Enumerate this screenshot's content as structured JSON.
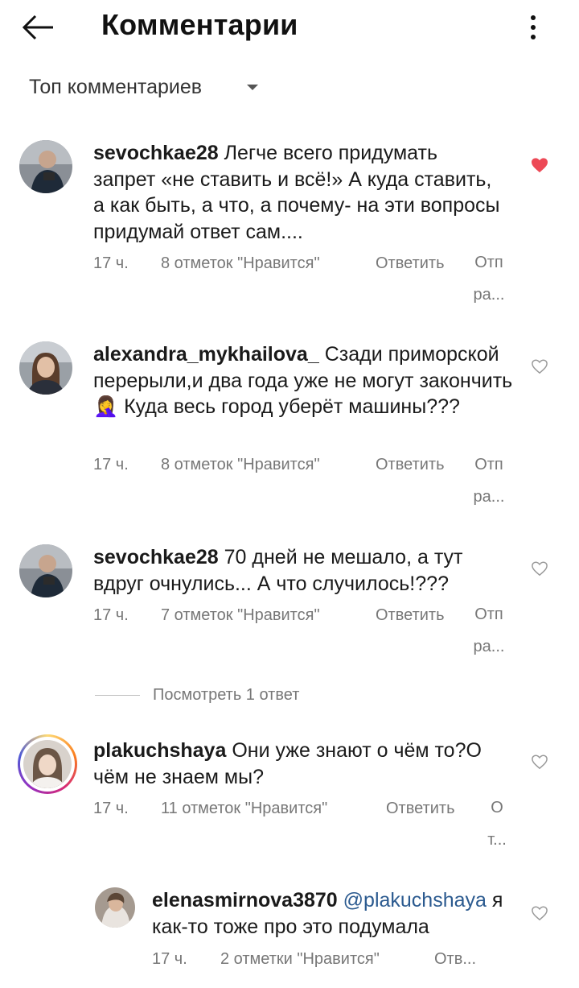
{
  "header": {
    "title": "Комментарии"
  },
  "sort": {
    "label": "Топ комментариев"
  },
  "colors": {
    "accent_heart": "#ed4956",
    "mention": "#2b5a8f",
    "meta": "#777777"
  },
  "comments": [
    {
      "username": "sevochkae28",
      "text": "Легче всего придумать запрет «не ставить и всё!» А куда ставить, а как быть, а что, а почему- на эти вопросы придумай ответ сам....",
      "time": "17 ч.",
      "likes": "8 отметок \"Нравится\"",
      "reply": "Ответить",
      "trunc1": "Отп",
      "trunc2": "ра...",
      "liked": true
    },
    {
      "username": "alexandra_mykhailova_",
      "text": "Сзади приморской перерыли,и два года уже не могут закончить🤦‍♀️ Куда весь город уберёт машины???",
      "time": "17 ч.",
      "likes": "8 отметок \"Нравится\"",
      "reply": "Ответить",
      "trunc1": "Отп",
      "trunc2": "ра...",
      "liked": false
    },
    {
      "username": "sevochkae28",
      "text": "70 дней не мешало, а тут вдруг очнулись... А что случилось!???",
      "time": "17 ч.",
      "likes": "7 отметок \"Нравится\"",
      "reply": "Ответить",
      "trunc1": "Отп",
      "trunc2": "ра...",
      "liked": false,
      "view_replies": "Посмотреть 1 ответ"
    },
    {
      "username": "plakuchshaya",
      "text": "Они уже знают о чём то?О чём не знаем мы?",
      "time": "17 ч.",
      "likes": "11 отметок \"Нравится\"",
      "reply": "Ответить",
      "trunc1": "О",
      "trunc2": "т...",
      "liked": false
    }
  ],
  "reply_comment": {
    "username": "elenasmirnova3870",
    "mention": "@plakuchshaya",
    "text": "я как-то тоже про это подумала",
    "time": "17 ч.",
    "likes": "2 отметки \"Нравится\"",
    "reply": "Отв..."
  }
}
